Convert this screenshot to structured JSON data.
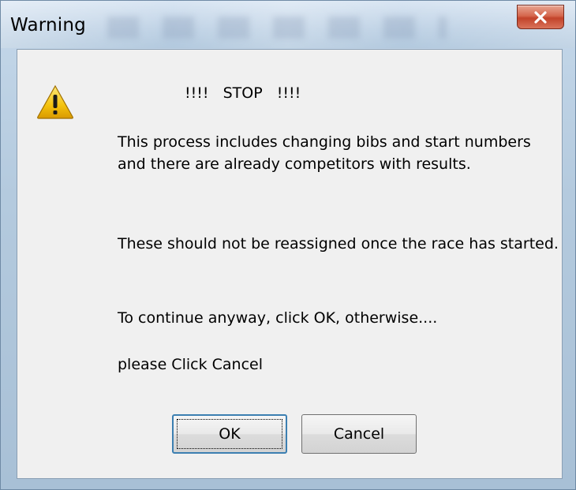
{
  "window": {
    "title": "Warning"
  },
  "dialog": {
    "heading": "!!!!   STOP   !!!!",
    "paragraphs": [
      "This process includes changing bibs and start numbers and there are already competitors with results.",
      "These should not be reassigned once the race has started.",
      "To continue anyway, click OK, otherwise....",
      "please Click Cancel"
    ],
    "icon": "warning-triangle-icon"
  },
  "buttons": {
    "ok_label": "OK",
    "cancel_label": "Cancel",
    "close_icon": "close-icon"
  },
  "colors": {
    "close_button": "#d5674d",
    "focus_border": "#3c7fb1",
    "warning_yellow": "#f4c20d"
  }
}
